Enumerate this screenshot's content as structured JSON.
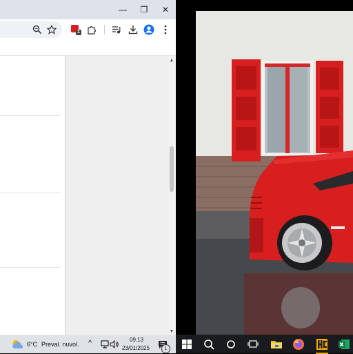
{
  "browser": {
    "window_controls": {
      "minimize": "—",
      "restore": "❐",
      "close": "✕"
    },
    "extension_badge": "1",
    "icons": [
      "zoom-icon",
      "bookmark-star-icon",
      "extension-icon",
      "puzzle-icon",
      "media-queue-icon",
      "download-icon",
      "profile-icon",
      "menu-icon"
    ],
    "scrollbar": {
      "up": "▲",
      "down": "▼"
    }
  },
  "taskbar": {
    "weather": {
      "temperature": "6°C",
      "condition": "Preval. nuvol."
    },
    "clock": {
      "time": "09.13",
      "date": "23/01/2025"
    },
    "notification_count": "1",
    "tray_arrow": "^"
  },
  "colors": {
    "titlebar": "#dee3eb",
    "accent_blue": "#1a73e8",
    "ferrari_red": "#d81f1f",
    "taskbar_dark": "#1a1b1e"
  }
}
